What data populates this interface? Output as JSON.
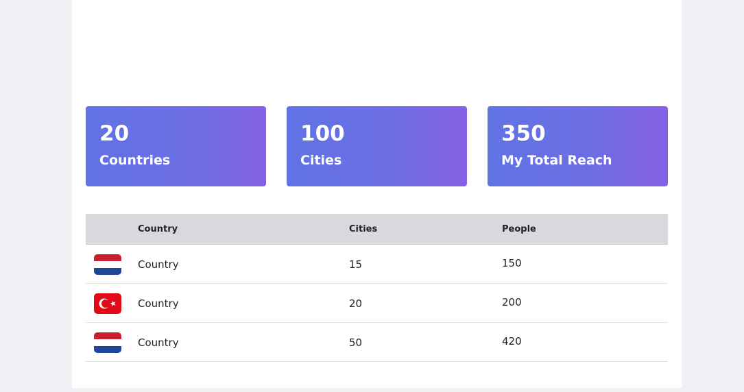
{
  "stats": [
    {
      "value": "20",
      "label": "Countries"
    },
    {
      "value": "100",
      "label": "Cities"
    },
    {
      "value": "350",
      "label": "My Total Reach"
    }
  ],
  "table": {
    "headers": {
      "country": "Country",
      "cities": "Cities",
      "people": "People"
    },
    "rows": [
      {
        "flag": "netherlands-flag-icon",
        "country": "Country",
        "cities": "15",
        "people": "150"
      },
      {
        "flag": "turkey-flag-icon",
        "country": "Country",
        "cities": "20",
        "people": "200"
      },
      {
        "flag": "netherlands-flag-icon",
        "country": "Country",
        "cities": "50",
        "people": "420"
      }
    ]
  },
  "colors": {
    "card_gradient_start": "#6073e5",
    "card_gradient_end": "#8560e3",
    "table_header_bg": "#d7d9dd",
    "page_bg": "#f0f1f5"
  }
}
